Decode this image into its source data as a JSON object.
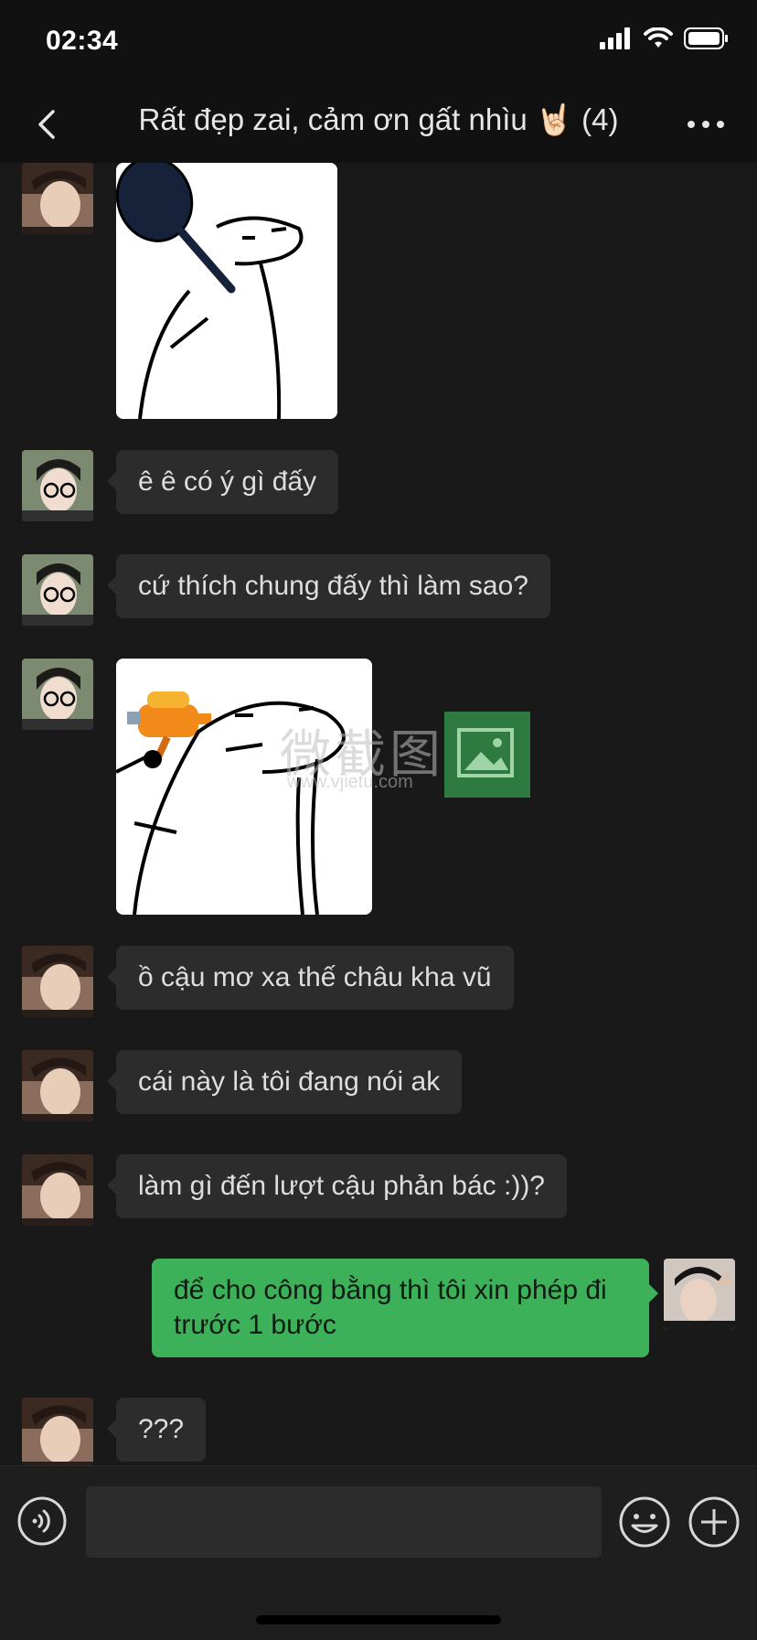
{
  "status_bar": {
    "time": "02:34"
  },
  "nav": {
    "title": "Rất đẹp zai, cảm ơn gất nhìu 🤘🏻 (4)"
  },
  "messages": [
    {
      "type": "sticker",
      "from": "other",
      "description": "frying-pan-meme"
    },
    {
      "type": "text",
      "from": "other",
      "text": "ê ê có ý gì đấy"
    },
    {
      "type": "text",
      "from": "other",
      "text": "cứ thích chung đấy thì làm sao?"
    },
    {
      "type": "sticker",
      "from": "other",
      "description": "water-gun-meme"
    },
    {
      "type": "text",
      "from": "other",
      "text": "ồ cậu mơ xa thế châu kha vũ"
    },
    {
      "type": "text",
      "from": "other",
      "text": "cái này là tôi đang nói ak"
    },
    {
      "type": "text",
      "from": "other",
      "text": "làm gì đến lượt cậu phản bác :))?"
    },
    {
      "type": "text",
      "from": "me",
      "text": "để cho công bằng thì tôi xin phép đi trước 1 bước"
    },
    {
      "type": "text",
      "from": "other",
      "text": "???"
    }
  ],
  "watermark": {
    "text": "微截图",
    "url": "www.vjietu.com"
  },
  "colors": {
    "my_bubble": "#3cb15a",
    "other_bubble": "#2c2c2c",
    "background": "#191919"
  },
  "icons": [
    "back-chevron-icon",
    "more-icon",
    "voice-icon",
    "emoji-icon",
    "plus-icon"
  ]
}
